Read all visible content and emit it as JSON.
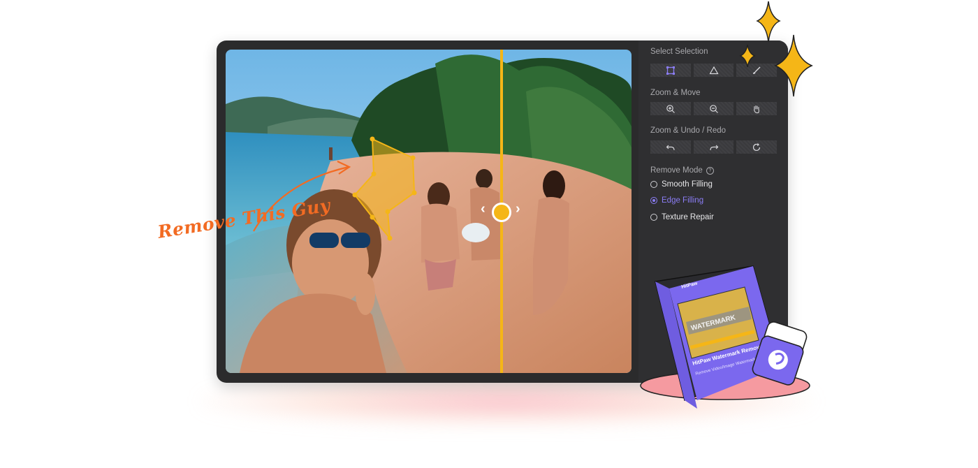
{
  "annotation": {
    "text": "Remove This Guy"
  },
  "panel": {
    "select_selection": {
      "title": "Select Selection",
      "tools": [
        "rectangle-select-icon",
        "polygon-select-icon",
        "brush-select-icon"
      ]
    },
    "zoom_move": {
      "title": "Zoom & Move",
      "tools": [
        "zoom-in-icon",
        "zoom-out-icon",
        "hand-icon"
      ]
    },
    "zoom_undo_redo": {
      "title": "Zoom & Undo / Redo",
      "tools": [
        "undo-icon",
        "redo-icon",
        "reset-icon"
      ]
    },
    "remove_mode": {
      "title": "Remove Mode",
      "options": [
        {
          "label": "Smooth Filling",
          "selected": false
        },
        {
          "label": "Edge Filling",
          "selected": true
        },
        {
          "label": "Texture Repair",
          "selected": false
        }
      ]
    }
  },
  "product_box": {
    "brand": "HitPaw",
    "screen_label": "WATERMARK",
    "name": "HitPaw Watermark Remover",
    "tagline": "Remove Video/Image Watermark with Ease"
  },
  "colors": {
    "accent": "#8b7df5",
    "divider": "#f5b617",
    "annotation": "#f26b23",
    "product": "#7b68ee"
  }
}
